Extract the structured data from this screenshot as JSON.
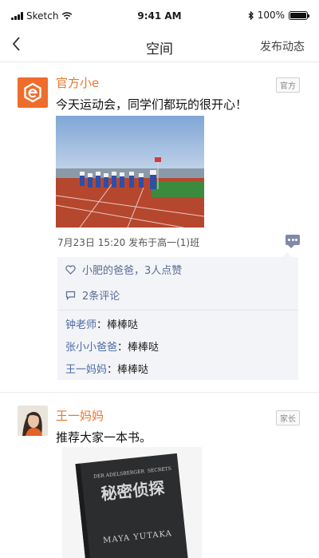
{
  "status_bar": {
    "carrier": "Sketch",
    "time": "9:41 AM",
    "battery": "100%"
  },
  "nav": {
    "back_icon": "chevron-left-icon",
    "title": "空间",
    "action": "发布动态"
  },
  "posts": [
    {
      "author": "官方小e",
      "tag": "官方",
      "text": "今天运动会，同学们都玩的很开心！",
      "meta": "7月23日 15:20 发布于高一(1)班",
      "likes": "小肥的爸爸，3人点赞",
      "comments_count": "2条评论",
      "comments": [
        {
          "name": "钟老师",
          "sep": "：",
          "text": "棒棒哒"
        },
        {
          "name": "张小小爸爸",
          "sep": "：",
          "text": "棒棒哒"
        },
        {
          "name": "王一妈妈",
          "sep": "：",
          "text": "棒棒哒"
        }
      ]
    },
    {
      "author": "王一妈妈",
      "tag": "家长",
      "text": "推荐大家一本书。",
      "book": {
        "subtitle": "DER ADELSBERGER  SECRETS",
        "title": "秘密侦探",
        "author_name": "MAYA YUTAKA"
      }
    }
  ],
  "colors": {
    "accent": "#e8772e",
    "link": "#4a6aa5",
    "panel": "#f3f4f7"
  }
}
